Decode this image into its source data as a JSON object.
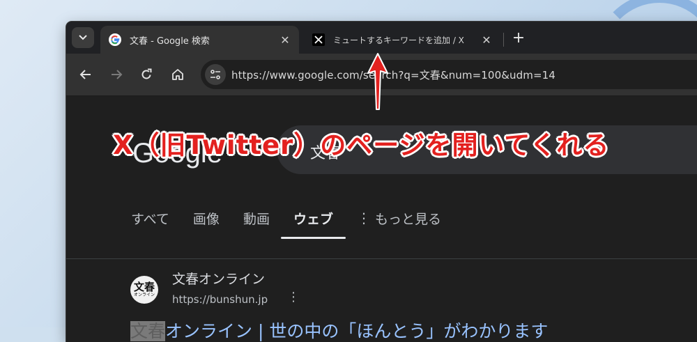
{
  "tabs": [
    {
      "title": "文春 - Google 検索",
      "active": true,
      "favicon": "google-g-icon"
    },
    {
      "title": "ミュートするキーワードを追加 / X",
      "active": false,
      "favicon": "x-logo-icon"
    }
  ],
  "toolbar": {
    "url": "https://www.google.com/search?q=文春&num=100&udm=14"
  },
  "google": {
    "logo_text": "Google",
    "query": "文春"
  },
  "search_tabs": {
    "items": [
      "すべて",
      "画像",
      "動画",
      "ウェブ"
    ],
    "active": "ウェブ",
    "more_label": "もっと見る"
  },
  "result": {
    "logo_big": "文春",
    "logo_small": "オンライン",
    "site_name": "文春オンライン",
    "site_url": "https://bunshun.jp",
    "title_highlight": "文春",
    "title_rest": "オンライン | 世の中の「ほんとう」がわかります"
  },
  "annotation": {
    "text": "X（旧Twitter）のページを開いてくれる",
    "color": "#e3211f"
  }
}
